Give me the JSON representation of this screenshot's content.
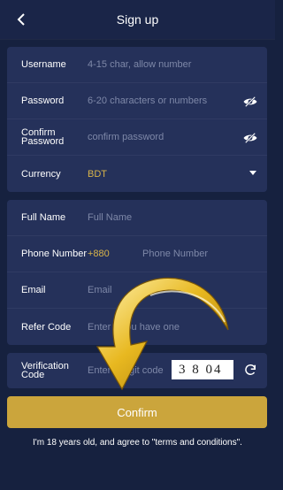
{
  "header": {
    "title": "Sign up"
  },
  "account": {
    "username_label": "Username",
    "username_placeholder": "4-15 char, allow number",
    "password_label": "Password",
    "password_placeholder": "6-20 characters or numbers",
    "confirm_label": "Confirm Password",
    "confirm_placeholder": "confirm password",
    "currency_label": "Currency",
    "currency_value": "BDT"
  },
  "profile": {
    "fullname_label": "Full Name",
    "fullname_placeholder": "Full Name",
    "phone_label": "Phone Number",
    "phone_prefix": "+880",
    "phone_placeholder": "Phone Number",
    "email_label": "Email",
    "email_placeholder": "Email",
    "refer_label": "Refer Code",
    "refer_placeholder": "Enter if you have one"
  },
  "verification": {
    "label": "Verification Code",
    "placeholder": "Enter 4 digit code",
    "captcha": "3 8 04"
  },
  "actions": {
    "confirm_label": "Confirm"
  },
  "terms": "I'm 18 years old, and agree to \"terms and conditions\".",
  "colors": {
    "accent": "#cba53c",
    "background": "#16213f",
    "card": "#25315a"
  }
}
